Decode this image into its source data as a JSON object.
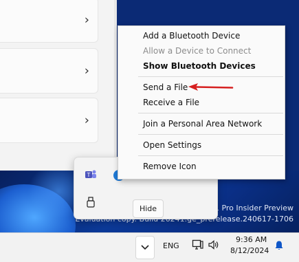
{
  "context_menu": {
    "items": [
      {
        "label": "Add a Bluetooth Device",
        "state": "enabled"
      },
      {
        "label": "Allow a Device to Connect",
        "state": "disabled"
      },
      {
        "label": "Show Bluetooth Devices",
        "state": "default"
      },
      {
        "label": "Send a File",
        "state": "enabled"
      },
      {
        "label": "Receive a File",
        "state": "enabled"
      },
      {
        "label": "Join a Personal Area Network",
        "state": "enabled"
      },
      {
        "label": "Open Settings",
        "state": "enabled"
      },
      {
        "label": "Remove Icon",
        "state": "enabled"
      }
    ]
  },
  "flyout": {
    "icons": [
      "teams-icon",
      "edge-icon",
      "app-icon",
      "app-icon",
      "app-icon",
      "usb-drive-icon"
    ],
    "hide_label": "Hide"
  },
  "desktop": {
    "watermark_line1": "11 Pro Insider Preview",
    "watermark_line2": "Evaluation copy. Build 26241.ge_prerelease.240617-1706"
  },
  "taskbar": {
    "language": "ENG",
    "time": "9:36 AM",
    "date": "8/12/2024",
    "icons": [
      "chevron-up-icon",
      "network-icon",
      "volume-icon",
      "notification-bell-icon"
    ]
  },
  "annotation": {
    "color": "#d62020"
  },
  "colors": {
    "taskbar_bg": "#f2f2f2",
    "menu_bg": "#fafafa",
    "accent_blue": "#0f56c7"
  }
}
